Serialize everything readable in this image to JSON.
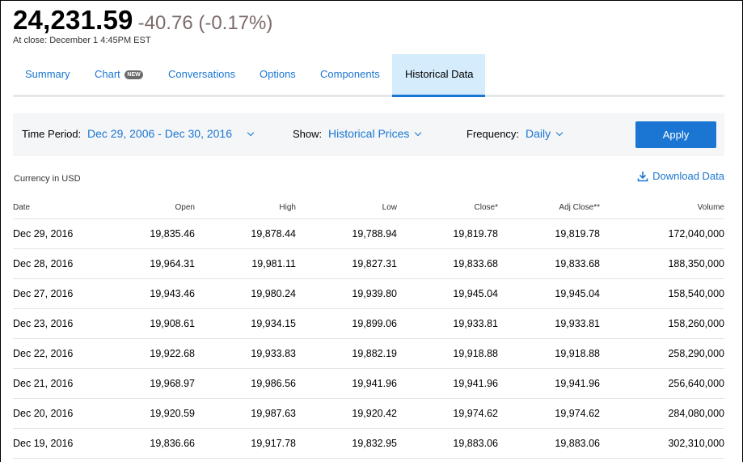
{
  "quote": {
    "price": "24,231.59",
    "change": "-40.76 (-0.17%)",
    "close_time": "At close: December 1 4:45PM EST"
  },
  "tabs": [
    {
      "label": "Summary",
      "active": false
    },
    {
      "label": "Chart",
      "badge": "NEW",
      "active": false
    },
    {
      "label": "Conversations",
      "active": false
    },
    {
      "label": "Options",
      "active": false
    },
    {
      "label": "Components",
      "active": false
    },
    {
      "label": "Historical Data",
      "active": true
    }
  ],
  "controls": {
    "time_period_label": "Time Period:",
    "time_period_value": "Dec 29, 2006 - Dec 30, 2016",
    "show_label": "Show:",
    "show_value": "Historical Prices",
    "frequency_label": "Frequency:",
    "frequency_value": "Daily",
    "apply_label": "Apply"
  },
  "currency_note": "Currency in USD",
  "download_label": "Download Data",
  "table": {
    "headers": [
      "Date",
      "Open",
      "High",
      "Low",
      "Close*",
      "Adj Close**",
      "Volume"
    ],
    "rows": [
      [
        "Dec 29, 2016",
        "19,835.46",
        "19,878.44",
        "19,788.94",
        "19,819.78",
        "19,819.78",
        "172,040,000"
      ],
      [
        "Dec 28, 2016",
        "19,964.31",
        "19,981.11",
        "19,827.31",
        "19,833.68",
        "19,833.68",
        "188,350,000"
      ],
      [
        "Dec 27, 2016",
        "19,943.46",
        "19,980.24",
        "19,939.80",
        "19,945.04",
        "19,945.04",
        "158,540,000"
      ],
      [
        "Dec 23, 2016",
        "19,908.61",
        "19,934.15",
        "19,899.06",
        "19,933.81",
        "19,933.81",
        "158,260,000"
      ],
      [
        "Dec 22, 2016",
        "19,922.68",
        "19,933.83",
        "19,882.19",
        "19,918.88",
        "19,918.88",
        "258,290,000"
      ],
      [
        "Dec 21, 2016",
        "19,968.97",
        "19,986.56",
        "19,941.96",
        "19,941.96",
        "19,941.96",
        "256,640,000"
      ],
      [
        "Dec 20, 2016",
        "19,920.59",
        "19,987.63",
        "19,920.42",
        "19,974.62",
        "19,974.62",
        "284,080,000"
      ],
      [
        "Dec 19, 2016",
        "19,836.66",
        "19,917.78",
        "19,832.95",
        "19,883.06",
        "19,883.06",
        "302,310,000"
      ]
    ]
  },
  "colors": {
    "accent": "#1a76d2",
    "change_negative": "#7d6b6b",
    "active_tab_bg": "#d4ecfb",
    "controls_bg": "#f4f6f7"
  }
}
